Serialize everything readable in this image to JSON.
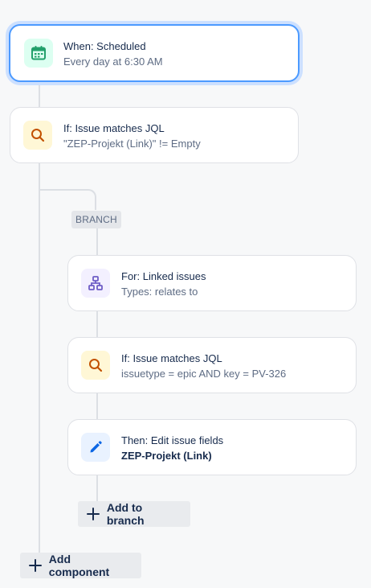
{
  "trigger": {
    "title": "When: Scheduled",
    "subtitle": "Every day at 6:30 AM",
    "icon": "calendar-icon",
    "accent": "#22a06b"
  },
  "condition": {
    "title": "If: Issue matches JQL",
    "subtitle": "\"ZEP-Projekt (Link)\" != Empty",
    "icon": "search-icon",
    "accent": "#c25100"
  },
  "branch": {
    "label": "BRANCH",
    "for": {
      "title": "For: Linked issues",
      "subtitle": "Types: relates to",
      "icon": "hierarchy-icon",
      "accent": "#6e5dc6"
    },
    "condition": {
      "title": "If: Issue matches JQL",
      "subtitle": "issuetype = epic AND key = PV-326",
      "icon": "search-icon",
      "accent": "#c25100"
    },
    "action": {
      "title": "Then: Edit issue fields",
      "subtitle": "ZEP-Projekt (Link)",
      "icon": "pencil-icon",
      "accent": "#0c66e4"
    },
    "add_label": "Add to branch"
  },
  "add_component_label": "Add component"
}
